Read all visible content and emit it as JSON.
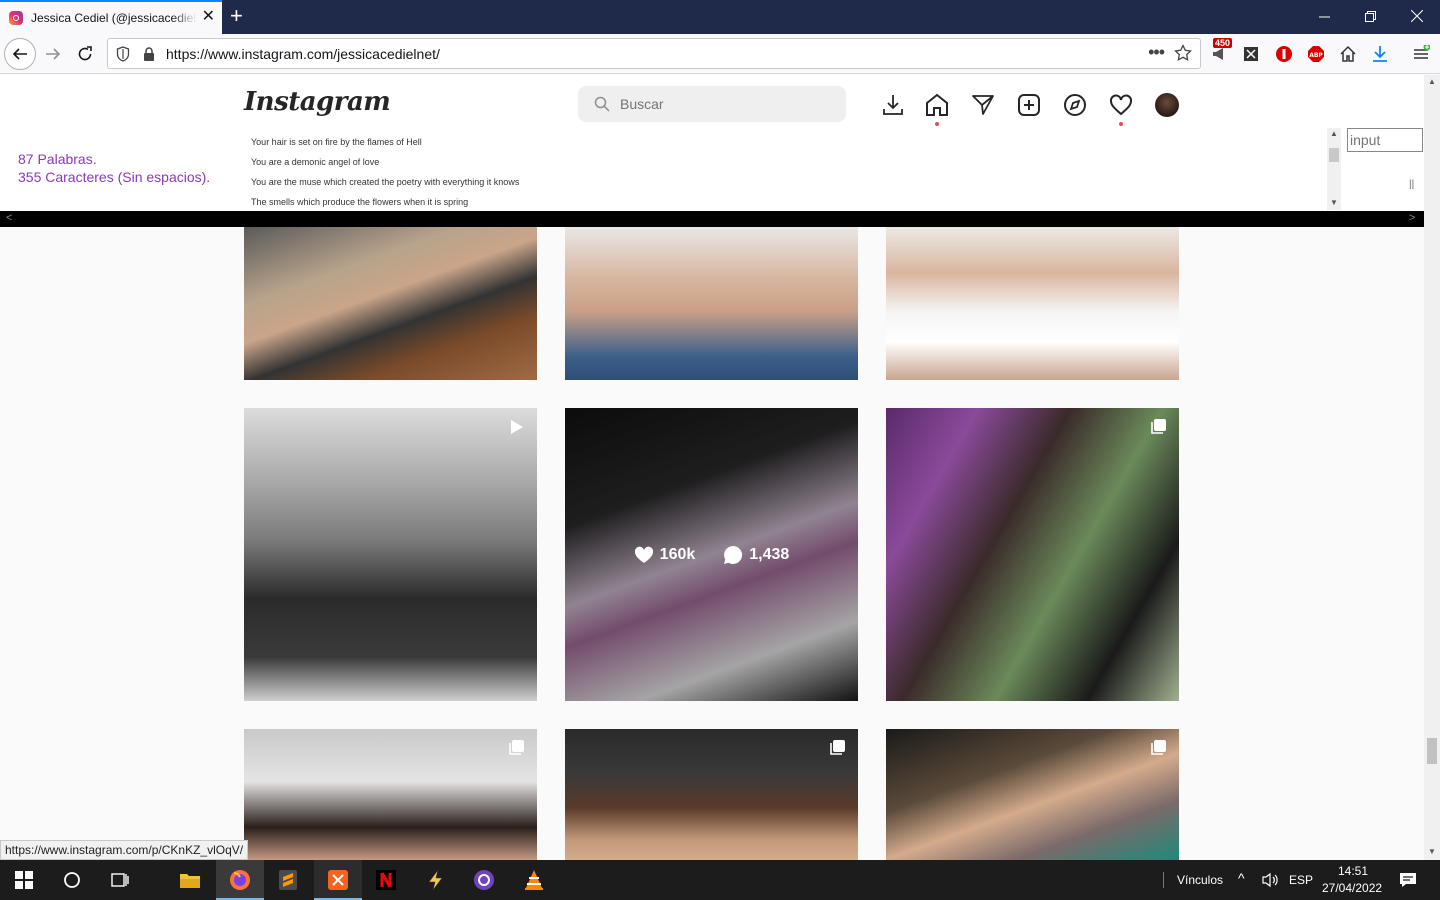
{
  "browser": {
    "tab_title": "Jessica Cediel (@jessicacedielnet)",
    "url": "https://www.instagram.com/jessicacedielnet/",
    "notification_badge": "450",
    "icons": [
      "back-icon",
      "forward-icon",
      "reload-icon",
      "shield-icon",
      "lock-icon",
      "star-icon",
      "downloads-icon",
      "menu-icon"
    ]
  },
  "instagram": {
    "logo": "Instagram",
    "search_placeholder": "Buscar",
    "nav_icons": [
      "download-icon",
      "home-icon",
      "direct-icon",
      "new-post-icon",
      "explore-icon",
      "activity-icon",
      "profile-avatar"
    ]
  },
  "overlay": {
    "word_count": "87 Palabras.",
    "char_count": "355 Caracteres (Sin espacios).",
    "lyrics": [
      "Your hair is set on fire by the flames of Hell",
      "You are a demonic angel of love",
      "You are the muse which created the poetry with everything it knows",
      "The smells which produce the flowers when it is spring"
    ],
    "input_placeholder": "input"
  },
  "grid": {
    "hover_likes": "160k",
    "hover_comments": "1,438"
  },
  "status_url": "https://www.instagram.com/p/CKnKZ_vlOqV/",
  "taskbar": {
    "links_label": "Vínculos",
    "language": "ESP",
    "time": "14:51",
    "date": "27/04/2022"
  },
  "colors": {
    "titlebar": "#1f2a4a",
    "accent": "#0a84ff",
    "counter_text": "#8a3ab9",
    "notification_dot": "#ed4956"
  }
}
